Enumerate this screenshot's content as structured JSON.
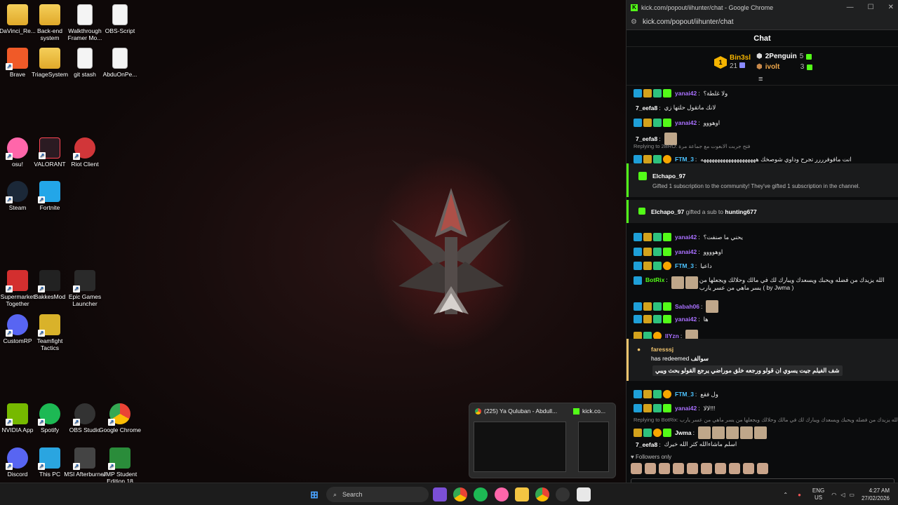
{
  "desktop": {
    "icons": [
      {
        "label": "DaVinci_Re...",
        "kind": "folder"
      },
      {
        "label": "Back-end system",
        "kind": "folder"
      },
      {
        "label": "Walkthrough Framer Mo...",
        "kind": "file"
      },
      {
        "label": "OBS-Script",
        "kind": "file"
      },
      {
        "label": "Brave",
        "kind": "app"
      },
      {
        "label": "TriageSystem",
        "kind": "folder"
      },
      {
        "label": "git stash",
        "kind": "file"
      },
      {
        "label": "AbduOnPe...",
        "kind": "file"
      },
      {
        "label": "osu!",
        "kind": "app"
      },
      {
        "label": "VALORANT",
        "kind": "app"
      },
      {
        "label": "Riot Client",
        "kind": "app"
      },
      {
        "label": "Steam",
        "kind": "app"
      },
      {
        "label": "Fortnite",
        "kind": "app"
      },
      {
        "label": "Supermarket Together",
        "kind": "app"
      },
      {
        "label": "BakkesMod",
        "kind": "app"
      },
      {
        "label": "Epic Games Launcher",
        "kind": "app"
      },
      {
        "label": "CustomRP",
        "kind": "app"
      },
      {
        "label": "Teamfight Tactics",
        "kind": "app"
      },
      {
        "label": "NVIDIA App",
        "kind": "app"
      },
      {
        "label": "Spotify",
        "kind": "app"
      },
      {
        "label": "OBS Studio",
        "kind": "app"
      },
      {
        "label": "Google Chrome",
        "kind": "app"
      },
      {
        "label": "Discord",
        "kind": "app"
      },
      {
        "label": "This PC",
        "kind": "app"
      },
      {
        "label": "MSI Afterburner",
        "kind": "app"
      },
      {
        "label": "JMP Student Edition 18",
        "kind": "app"
      }
    ]
  },
  "chrome": {
    "window_title": "kick.com/popout/iihunter/chat - Google Chrome",
    "url": "kick.com/popout/iihunter/chat",
    "chat_title": "Chat",
    "leaderboard": {
      "first": {
        "rank": "1",
        "name": "Bin3sl",
        "count": "21"
      },
      "second": {
        "name": "2Penguin",
        "count": "5"
      },
      "third": {
        "name": "ivolt",
        "count": "3"
      }
    },
    "messages": [
      {
        "user": "yanai42",
        "color": "#a970ff",
        "text": "ولا غلطة؟"
      },
      {
        "user": "7_eefa8",
        "color": "#ffffff",
        "text": "لانك ماتقول حلتها زي"
      },
      {
        "user": "yanai42",
        "color": "#a970ff",
        "text": "اوهووو"
      },
      {
        "user": "7_eefa8",
        "color": "#ffffff",
        "text": ""
      },
      {
        "reply": "Replying to 2BRO: فتح جربت الابعوت مع جماعة مرة"
      },
      {
        "user": "FTM_3",
        "color": "#4cc3ff",
        "text": "انت مافوفرررر تجرح وداوي شوصخك ههههههههههههههههههههه"
      },
      {
        "user": "yanai42",
        "color": "#a970ff",
        "text": "يحني ما صنفت؟"
      },
      {
        "user": "yanai42",
        "color": "#a970ff",
        "text": "اوهوووو"
      },
      {
        "user": "FTM_3",
        "color": "#4cc3ff",
        "text": "داعيا"
      },
      {
        "user": "BotRix",
        "color": "#53fc18",
        "text": "الله يزيدك من فضله ويحبك ويسعدك ويبارك لك في مالك وحلالك ويجعلها من يسر ماهي من عسر يارب ( by Jwma )"
      },
      {
        "user": "Sabah06",
        "color": "#a970ff",
        "text": ""
      },
      {
        "user": "yanai42",
        "color": "#a970ff",
        "text": "ها"
      },
      {
        "user": "IIYzn",
        "color": "#a970ff",
        "text": ""
      },
      {
        "user": "FTM_3",
        "color": "#4cc3ff",
        "text": "ول فقع"
      },
      {
        "user": "yanai42",
        "color": "#a970ff",
        "text": "لالا!!!"
      },
      {
        "reply": "Replying to BotRix: الله يزيدك من فضله ويحبك ويسعدك ويبارك لك في مالك وحلالك ويجعلها من يسر ماهي من عسر يارب"
      },
      {
        "user": "Jwma",
        "color": "#ffffff",
        "text": ""
      },
      {
        "user": "7_eefa8",
        "color": "#ffffff",
        "text": "اسلم ماشاءالله كثر الله خيرك"
      }
    ],
    "gift_event": {
      "user": "Elchapo_97",
      "text": "Gifted 1 subscription to the community! They've gifted 1 subscription in the channel."
    },
    "gift_sub_event": {
      "user": "Elchapo_97",
      "middle": "gifted a sub to",
      "target": "hunting677"
    },
    "redeem_event": {
      "user": "faresssj",
      "text": "has redeemed",
      "reward": "سوالف",
      "message": "شف الفيلم جيت يسوي ان قولو ورجعه خلق موراضي يرجع القولو بحث ويبي"
    },
    "followers_only": "Followers only"
  },
  "preview": {
    "tab1": "(225) Ya Quluban - Abdull...",
    "tab2": "kick.co..."
  },
  "taskbar": {
    "search_placeholder": "Search",
    "lang_top": "ENG",
    "lang_bottom": "US",
    "time": "4:27 AM",
    "date": "27/02/2026"
  },
  "colors": {
    "kick_green": "#53fc18",
    "accent_purple": "#a970ff"
  }
}
